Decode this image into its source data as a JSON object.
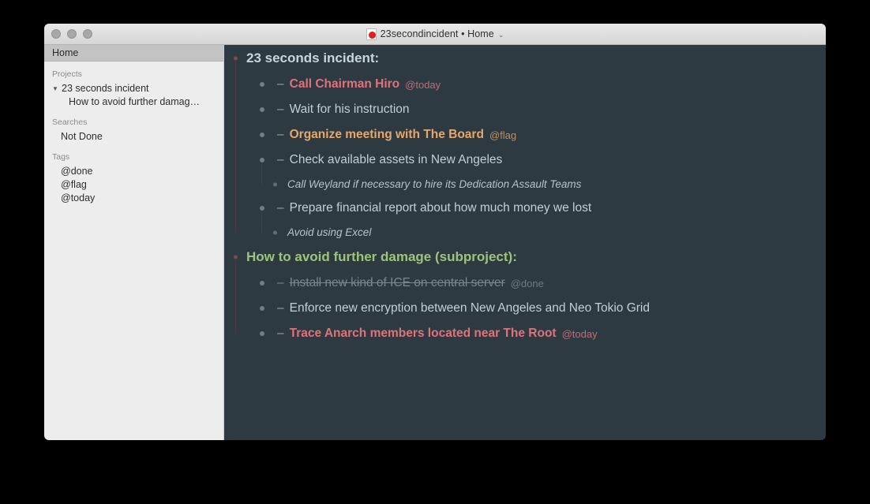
{
  "window": {
    "title": "23secondincident • Home",
    "doc_icon": "tomato-document-icon",
    "chevron": "⌄",
    "traffic_lights": [
      "close-button",
      "minimize-button",
      "zoom-button"
    ]
  },
  "sidebar": {
    "header_label": "Home",
    "sections": [
      {
        "label": "Projects",
        "items": [
          {
            "label": "23 seconds incident",
            "disclosure": "▼",
            "level": 0
          },
          {
            "label": "How to avoid further damag…",
            "disclosure": "",
            "level": 1
          }
        ]
      },
      {
        "label": "Searches",
        "items": [
          {
            "label": "Not Done",
            "disclosure": "",
            "level": 0
          }
        ]
      },
      {
        "label": "Tags",
        "items": [
          {
            "label": "@done",
            "disclosure": "",
            "level": 0
          },
          {
            "label": "@flag",
            "disclosure": "",
            "level": 0
          },
          {
            "label": "@today",
            "disclosure": "",
            "level": 0
          }
        ]
      }
    ]
  },
  "outline": {
    "rows": [
      {
        "kind": "project",
        "indent": 0,
        "dash": "",
        "text": "23 seconds incident:",
        "tag": ""
      },
      {
        "kind": "task",
        "indent": 1,
        "dash": "–",
        "text": "Call Chairman Hiro",
        "tag": "@today",
        "color": "red"
      },
      {
        "kind": "task",
        "indent": 1,
        "dash": "–",
        "text": "Wait for his instruction",
        "tag": "",
        "color": ""
      },
      {
        "kind": "task",
        "indent": 1,
        "dash": "–",
        "text": "Organize meeting with The Board",
        "tag": "@flag",
        "color": "orange"
      },
      {
        "kind": "task",
        "indent": 1,
        "dash": "–",
        "text": "Check available assets in New Angeles",
        "tag": "",
        "color": ""
      },
      {
        "kind": "note",
        "indent": 2,
        "dash": "",
        "text": "Call Weyland if necessary to  hire its Dedication Assault Teams",
        "tag": ""
      },
      {
        "kind": "task",
        "indent": 1,
        "dash": "–",
        "text": "Prepare financial report about how much money we lost",
        "tag": "",
        "color": ""
      },
      {
        "kind": "note",
        "indent": 2,
        "dash": "",
        "text": "Avoid using Excel",
        "tag": ""
      },
      {
        "kind": "subproject",
        "indent": 0,
        "dash": "",
        "text": "How to avoid further damage (subproject):",
        "tag": ""
      },
      {
        "kind": "task",
        "indent": 1,
        "dash": "–",
        "text": "Install new kind of ICE on central server",
        "tag": "@done",
        "color": "done"
      },
      {
        "kind": "task",
        "indent": 1,
        "dash": "–",
        "text": "Enforce new encryption between New Angeles and Neo Tokio Grid",
        "tag": "",
        "color": ""
      },
      {
        "kind": "task",
        "indent": 1,
        "dash": "–",
        "text": "Trace Anarch members located near The Root",
        "tag": "@today",
        "color": "red"
      }
    ]
  },
  "colors": {
    "content_bg": "#2e3a42",
    "sidebar_bg": "#ededed",
    "sidebar_header_bg": "#c3c3c3",
    "accent_red": "#e0727a",
    "accent_orange": "#e8a76a",
    "accent_green": "#9ec479",
    "text_primary": "#c3ced6",
    "text_done": "#79878f",
    "guide_line": "#4a3b42",
    "page_bg": "#000000"
  }
}
